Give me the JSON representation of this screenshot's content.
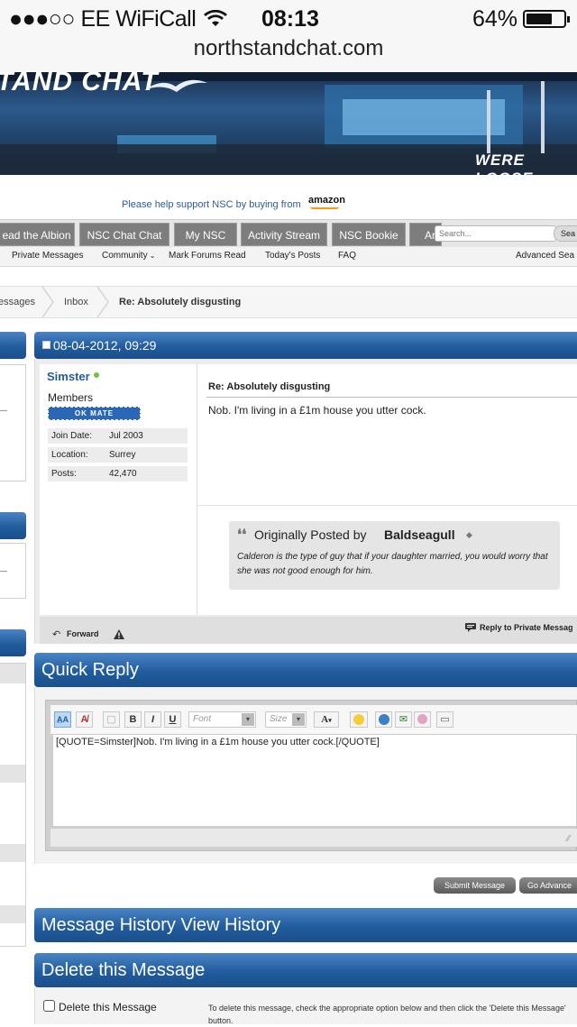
{
  "status": {
    "carrier": "●●●○○ EE WiFiCall",
    "time": "08:13",
    "battery": "64%"
  },
  "browser": {
    "url": "northstandchat.com"
  },
  "banner": {
    "logo_text": "TAND CHAT",
    "corner_text": "WERE LOOSE"
  },
  "support": {
    "text": "Please help support NSC by buying from",
    "amazon": "amazon"
  },
  "nav": {
    "tabs": [
      "ead the Albion",
      "NSC Chat Chat",
      "My NSC",
      "Activity Stream",
      "NSC Bookie",
      "Ar"
    ],
    "search_placeholder": "Search...",
    "search_button": "Sea"
  },
  "subnav": {
    "items": [
      "Private Messages",
      "Community",
      "Mark Forums Read",
      "Today's Posts",
      "FAQ"
    ],
    "advanced": "Advanced Sea"
  },
  "breadcrumb": {
    "items": [
      "essages",
      "Inbox",
      "Re: Absolutely disgusting"
    ]
  },
  "message": {
    "date": "08-04-2012, 09:29",
    "username": "Simster",
    "role": "Members",
    "rank_badge": "OK MATE",
    "info": [
      {
        "label": "Join Date:",
        "value": "Jul 2003"
      },
      {
        "label": "Location:",
        "value": "Surrey"
      },
      {
        "label": "Posts:",
        "value": "42,470"
      }
    ],
    "title": "Re: Absolutely disgusting",
    "body": "Nob. I'm living in a £1m house you utter cock.",
    "quote_prefix": "Originally Posted by",
    "quote_author": "Baldseagull",
    "quote_text": "Calderon is the type of guy that if your daughter married, you would worry that she was not good enough for him.",
    "forward": "Forward",
    "reply_private": "Reply to Private Messag"
  },
  "quick_reply": {
    "title": "Quick Reply",
    "font_placeholder": "Font",
    "size_placeholder": "Size",
    "editor_text": "[QUOTE=Simster]Nob.  I'm living in a £1m house you utter cock.[/QUOTE]",
    "submit": "Submit Message",
    "go_advanced": "Go Advance"
  },
  "history": {
    "title": "Message History View History"
  },
  "delete": {
    "title": "Delete this Message",
    "checkbox_label": "Delete this Message",
    "hint": "To delete this message, check the appropriate option below and then click the 'Delete this Message' button."
  }
}
